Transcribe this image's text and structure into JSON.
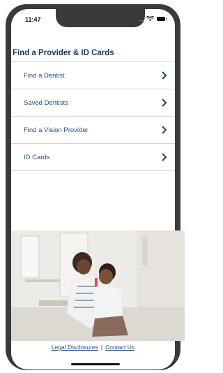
{
  "status_bar": {
    "time": "11:47",
    "dots": "...."
  },
  "page": {
    "title": "Find a Provider & ID Cards"
  },
  "menu": {
    "items": [
      {
        "label": "Find a Dentist"
      },
      {
        "label": "Saved Dentists"
      },
      {
        "label": "Find a Vision Provider"
      },
      {
        "label": "ID Cards"
      }
    ]
  },
  "footer": {
    "legal": "Legal Disclosures",
    "separator": "|",
    "contact": "Contact Us"
  },
  "colors": {
    "title": "#1b365d",
    "link": "#1f4e78",
    "divider": "#cfd6de",
    "frame": "#3a3a3a"
  }
}
